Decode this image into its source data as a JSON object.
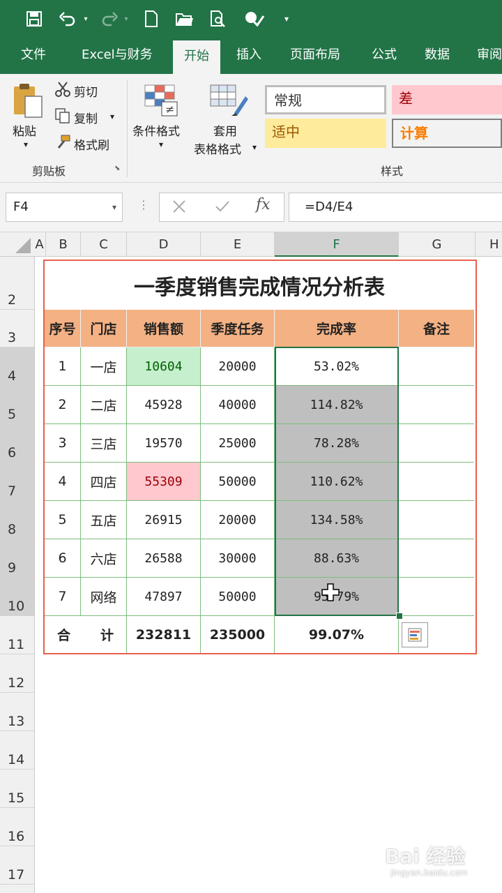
{
  "ribbon_tabs": [
    "文件",
    "Excel与财务",
    "开始",
    "插入",
    "页面布局",
    "公式",
    "数据",
    "审阅"
  ],
  "active_tab": "开始",
  "clipboard": {
    "paste": "粘贴",
    "cut": "剪切",
    "copy": "复制",
    "format_painter": "格式刷",
    "group": "剪贴板"
  },
  "styles": {
    "conditional_format": "条件格式",
    "table_format_1": "套用",
    "table_format_2": "表格格式",
    "normal": "常规",
    "bad": "差",
    "neutral": "适中",
    "calculation": "计算",
    "group": "样式",
    "colors": {
      "bad_bg": "#ffc7ce",
      "bad_fg": "#9c0006",
      "neutral_bg": "#ffeb9c",
      "neutral_fg": "#9c5700",
      "calc_bg": "#f2f2f2",
      "calc_fg": "#fa7d00"
    }
  },
  "formula_bar": {
    "name_box": "F4",
    "formula": "=D4/E4"
  },
  "columns": [
    "A",
    "B",
    "C",
    "D",
    "E",
    "F",
    "G",
    "H"
  ],
  "rows": [
    "2",
    "3",
    "4",
    "5",
    "6",
    "7",
    "8",
    "9",
    "10",
    "11",
    "12",
    "13",
    "14",
    "15",
    "16",
    "17"
  ],
  "sheet": {
    "title": "一季度销售完成情况分析表",
    "headers": [
      "序号",
      "门店",
      "销售额",
      "季度任务",
      "完成率",
      "备注"
    ],
    "data_rows": [
      [
        "1",
        "一店",
        "10604",
        "20000",
        "53.02%",
        ""
      ],
      [
        "2",
        "二店",
        "45928",
        "40000",
        "114.82%",
        ""
      ],
      [
        "3",
        "三店",
        "19570",
        "25000",
        "78.28%",
        ""
      ],
      [
        "4",
        "四店",
        "55309",
        "50000",
        "110.62%",
        ""
      ],
      [
        "5",
        "五店",
        "26915",
        "20000",
        "134.58%",
        ""
      ],
      [
        "6",
        "六店",
        "26588",
        "30000",
        "88.63%",
        ""
      ],
      [
        "7",
        "网络",
        "47897",
        "50000",
        "95.79%",
        ""
      ]
    ],
    "total": {
      "label_1": "合",
      "label_2": "计",
      "sales": "232811",
      "target": "235000",
      "rate": "99.07%"
    }
  },
  "watermark": {
    "brand": "Bai 经验",
    "url": "jingyan.baidu.com"
  }
}
